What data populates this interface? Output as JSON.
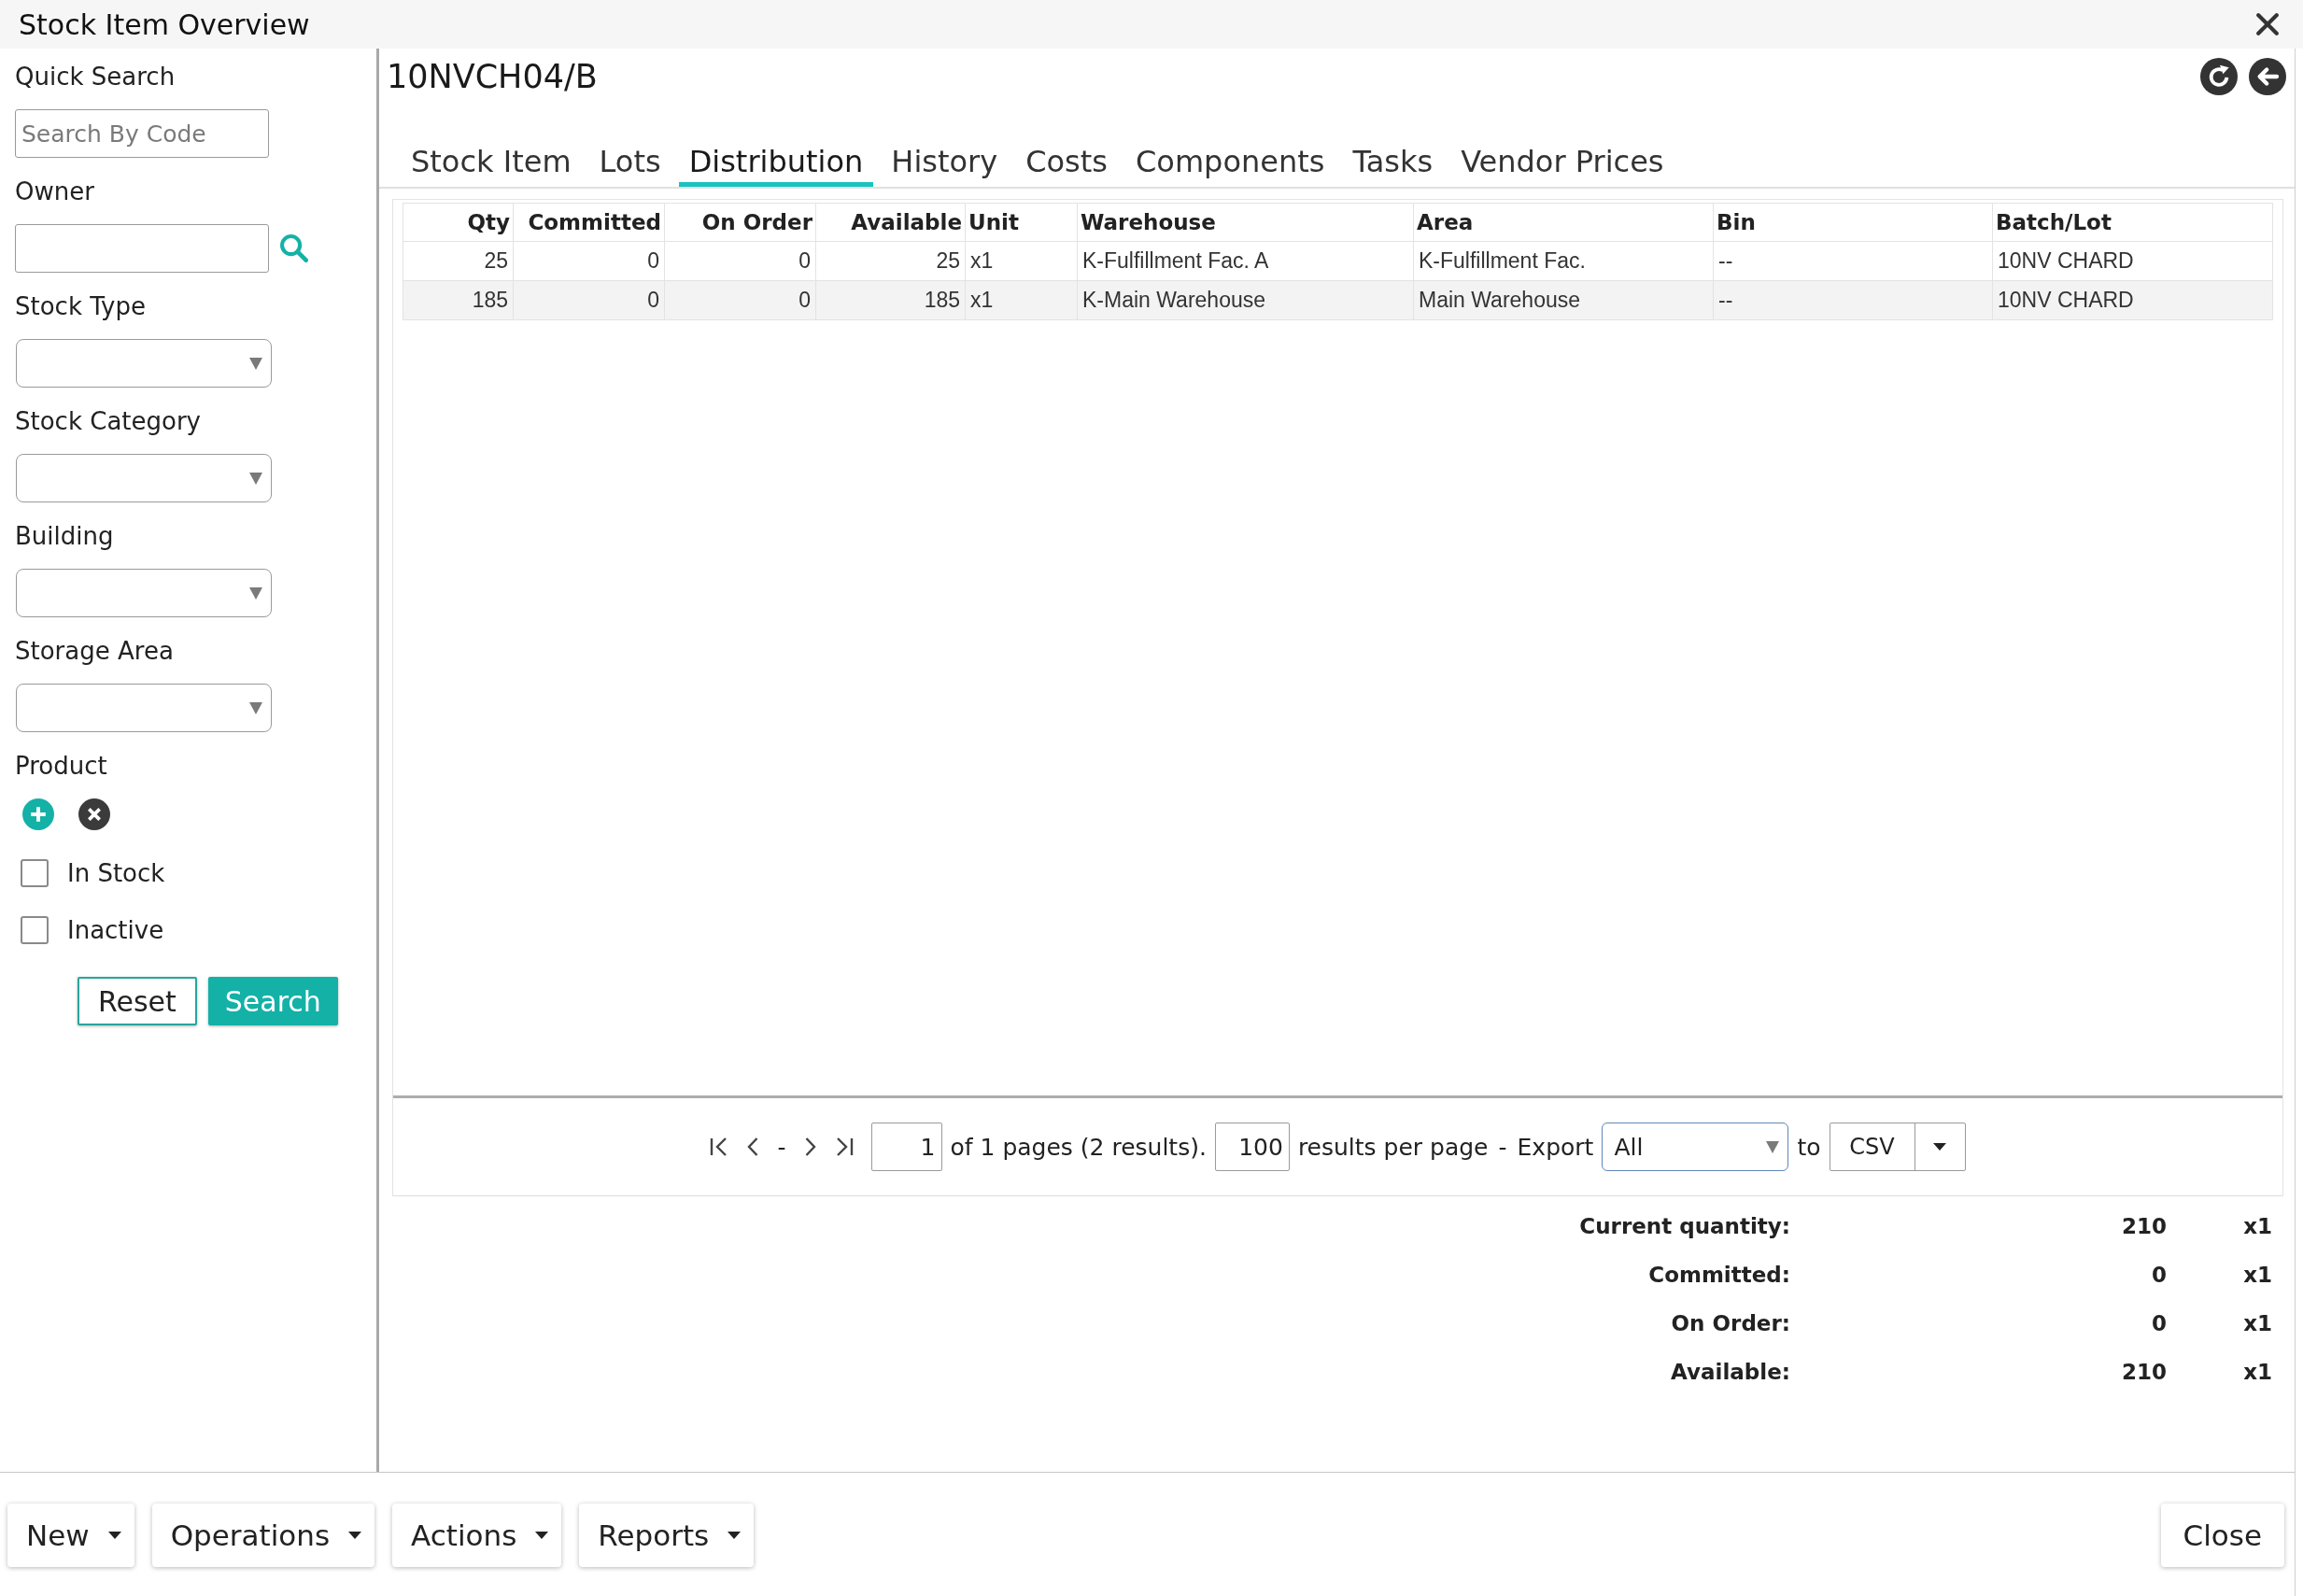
{
  "window": {
    "title": "Stock Item Overview"
  },
  "sidebar": {
    "filters": [
      {
        "kind": "text",
        "label": "Quick Search",
        "placeholder": "Search By Code"
      },
      {
        "kind": "lookup",
        "label": "Owner"
      },
      {
        "kind": "select",
        "label": "Stock Type"
      },
      {
        "kind": "select",
        "label": "Stock Category"
      },
      {
        "kind": "select",
        "label": "Building"
      },
      {
        "kind": "select",
        "label": "Storage Area"
      },
      {
        "kind": "picker",
        "label": "Product"
      }
    ],
    "checkboxes": [
      {
        "label": "In Stock",
        "checked": false
      },
      {
        "label": "Inactive",
        "checked": false
      }
    ],
    "buttons": [
      {
        "label": "Reset",
        "kind": "secondary"
      },
      {
        "label": "Search",
        "kind": "primary"
      }
    ]
  },
  "item": {
    "code": "10NVCH04/B"
  },
  "tabs": [
    {
      "label": "Stock Item",
      "selected": false
    },
    {
      "label": "Lots",
      "selected": false
    },
    {
      "label": "Distribution",
      "selected": true
    },
    {
      "label": "History",
      "selected": false
    },
    {
      "label": "Costs",
      "selected": false
    },
    {
      "label": "Components",
      "selected": false
    },
    {
      "label": "Tasks",
      "selected": false
    },
    {
      "label": "Vendor Prices",
      "selected": false
    }
  ],
  "table": {
    "columns": [
      {
        "label": "Qty",
        "kind": "number"
      },
      {
        "label": "Committed",
        "kind": "number"
      },
      {
        "label": "On Order",
        "kind": "number"
      },
      {
        "label": "Available",
        "kind": "number"
      },
      {
        "label": "Unit",
        "kind": "text"
      },
      {
        "label": "Warehouse",
        "kind": "text"
      },
      {
        "label": "Area",
        "kind": "text"
      },
      {
        "label": "Bin",
        "kind": "text"
      },
      {
        "label": "Batch/Lot",
        "kind": "text"
      }
    ],
    "rows": [
      {
        "cells": [
          "25",
          "0",
          "0",
          "25",
          "x1",
          "K-Fulfillment Fac. A",
          "K-Fulfillment Fac.",
          "--",
          "10NV CHARD"
        ]
      },
      {
        "cells": [
          "185",
          "0",
          "0",
          "185",
          "x1",
          "K-Main Warehouse",
          "Main Warehouse",
          "--",
          "10NV CHARD"
        ]
      }
    ]
  },
  "pagination": {
    "nav_separator": "-",
    "page": "1",
    "page_info": "of 1 pages (2 results).",
    "page_size": "100",
    "page_size_label": "results per page",
    "separator": "-",
    "export_label": "Export",
    "export_scope": {
      "value": "All",
      "focused": true
    },
    "to_label": "to",
    "format": "CSV"
  },
  "summary": [
    {
      "label": "Current quantity:",
      "value": "210",
      "unit": "x1"
    },
    {
      "label": "Committed:",
      "value": "0",
      "unit": "x1"
    },
    {
      "label": "On Order:",
      "value": "0",
      "unit": "x1"
    },
    {
      "label": "Available:",
      "value": "210",
      "unit": "x1"
    }
  ],
  "footer": {
    "menus": [
      "New",
      "Operations",
      "Actions",
      "Reports"
    ],
    "close_button": "Close"
  }
}
